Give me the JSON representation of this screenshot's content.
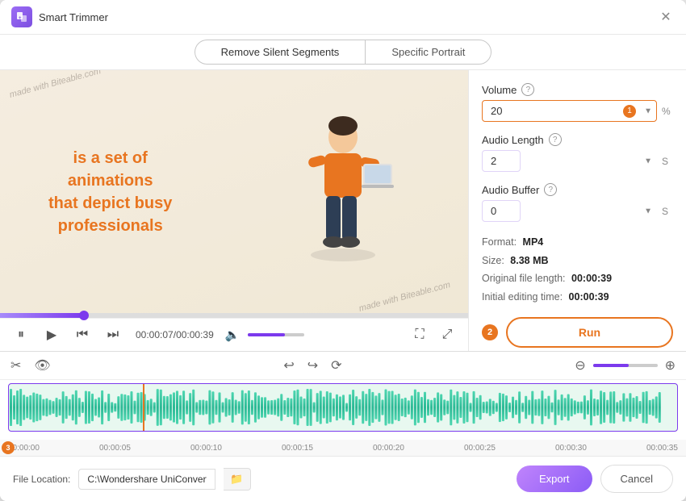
{
  "window": {
    "title": "Smart Trimmer",
    "close_label": "✕"
  },
  "tabs": {
    "items": [
      {
        "label": "Remove Silent Segments",
        "active": true
      },
      {
        "label": "Specific Portrait",
        "active": false
      }
    ]
  },
  "video": {
    "watermark_tl": "made with\nBiteable.com",
    "watermark_br": "made with\nBiteable.com",
    "text_line1": "is a set of",
    "text_line2": "animations",
    "text_line3": "that depict busy",
    "text_line4": "professionals"
  },
  "controls": {
    "time_current": "00:00:07",
    "time_total": "00:00:39"
  },
  "right_panel": {
    "volume_label": "Volume",
    "volume_value": "20",
    "volume_badge": "1",
    "volume_unit": "%",
    "audio_length_label": "Audio Length",
    "audio_length_value": "2",
    "audio_length_unit": "S",
    "audio_buffer_label": "Audio Buffer",
    "audio_buffer_value": "0",
    "audio_buffer_unit": "S",
    "format_label": "Format:",
    "format_value": "MP4",
    "size_label": "Size:",
    "size_value": "8.38 MB",
    "orig_len_label": "Original file length:",
    "orig_len_value": "00:00:39",
    "init_time_label": "Initial editing time:",
    "init_time_value": "00:00:39",
    "run_badge": "2",
    "run_label": "Run"
  },
  "timeline": {
    "ruler_marks": [
      "00:00:00",
      "00:00:05",
      "00:00:10",
      "00:00:15",
      "00:00:20",
      "00:00:25",
      "00:00:30",
      "00:00:35"
    ],
    "badge_3": "3"
  },
  "bottom": {
    "file_loc_label": "File Location:",
    "file_loc_value": "C:\\Wondershare UniConverter",
    "export_label": "Export",
    "cancel_label": "Cancel"
  }
}
